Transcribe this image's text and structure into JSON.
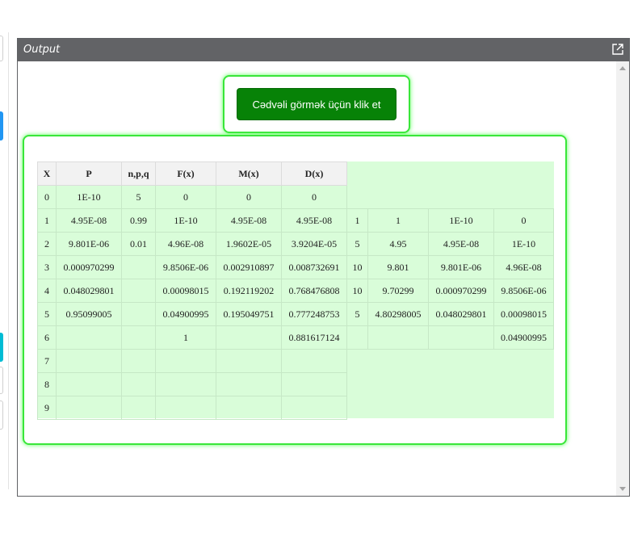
{
  "panel": {
    "title": "Output"
  },
  "button": {
    "label": "Cədvəli görmək üçün klik et"
  },
  "table": {
    "headers": [
      "X",
      "P",
      "n,p,q",
      "F(x)",
      "M(x)",
      "D(x)"
    ],
    "rows": [
      [
        "0",
        "1E-10",
        "5",
        "0",
        "0",
        "0",
        "",
        "",
        "",
        ""
      ],
      [
        "1",
        "4.95E-08",
        "0.99",
        "1E-10",
        "4.95E-08",
        "4.95E-08",
        "1",
        "1",
        "1E-10",
        "0"
      ],
      [
        "2",
        "9.801E-06",
        "0.01",
        "4.96E-08",
        "1.9602E-05",
        "3.9204E-05",
        "5",
        "4.95",
        "4.95E-08",
        "1E-10"
      ],
      [
        "3",
        "0.000970299",
        "",
        "9.8506E-06",
        "0.002910897",
        "0.008732691",
        "10",
        "9.801",
        "9.801E-06",
        "4.96E-08"
      ],
      [
        "4",
        "0.048029801",
        "",
        "0.00098015",
        "0.192119202",
        "0.768476808",
        "10",
        "9.70299",
        "0.000970299",
        "9.8506E-06"
      ],
      [
        "5",
        "0.95099005",
        "",
        "0.04900995",
        "0.195049751",
        "0.777248753",
        "5",
        "4.80298005",
        "0.048029801",
        "0.00098015"
      ],
      [
        "6",
        "",
        "",
        "1",
        "",
        "0.881617124",
        "",
        "",
        "",
        "0.04900995"
      ],
      [
        "7",
        "",
        "",
        "",
        "",
        "",
        "",
        "",
        "",
        ""
      ],
      [
        "8",
        "",
        "",
        "",
        "",
        "",
        "",
        "",
        "",
        ""
      ],
      [
        "9",
        "",
        "",
        "",
        "",
        "",
        "",
        "",
        "",
        ""
      ]
    ]
  }
}
